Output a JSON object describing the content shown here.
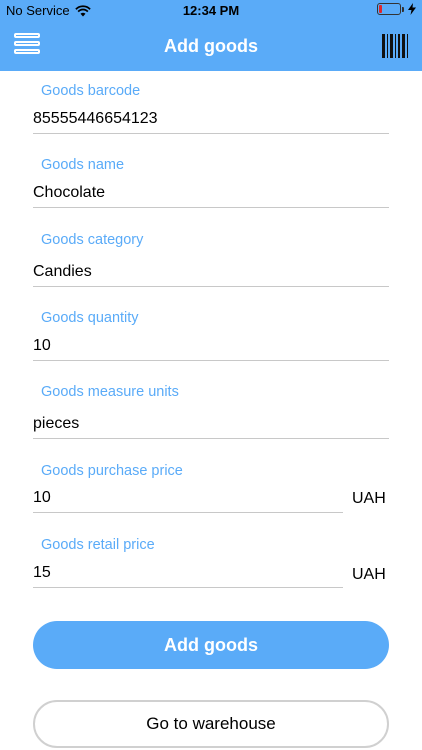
{
  "status_bar": {
    "carrier": "No Service",
    "time": "12:34 PM",
    "battery_level": 0.15,
    "battery_color": "#e0262c",
    "wifi_icon": "wifi-icon",
    "charging_icon": "lightning-icon"
  },
  "header": {
    "title": "Add goods",
    "menu_icon": "menu-icon",
    "barcode_icon": "barcode-icon",
    "accent_color": "#5aabf8"
  },
  "form": {
    "barcode": {
      "label": "Goods barcode",
      "value": "85555446654123"
    },
    "name": {
      "label": "Goods name",
      "value": "Chocolate"
    },
    "category": {
      "label": "Goods category",
      "value": "Candies"
    },
    "quantity": {
      "label": "Goods quantity",
      "value": "10"
    },
    "measure_units": {
      "label": "Goods measure units",
      "value": "pieces"
    },
    "purchase_price": {
      "label": "Goods purchase price",
      "value": "10",
      "unit": "UAH"
    },
    "retail_price": {
      "label": "Goods retail price",
      "value": "15",
      "unit": "UAH"
    }
  },
  "actions": {
    "add_goods": "Add goods",
    "go_to_warehouse": "Go to warehouse"
  }
}
